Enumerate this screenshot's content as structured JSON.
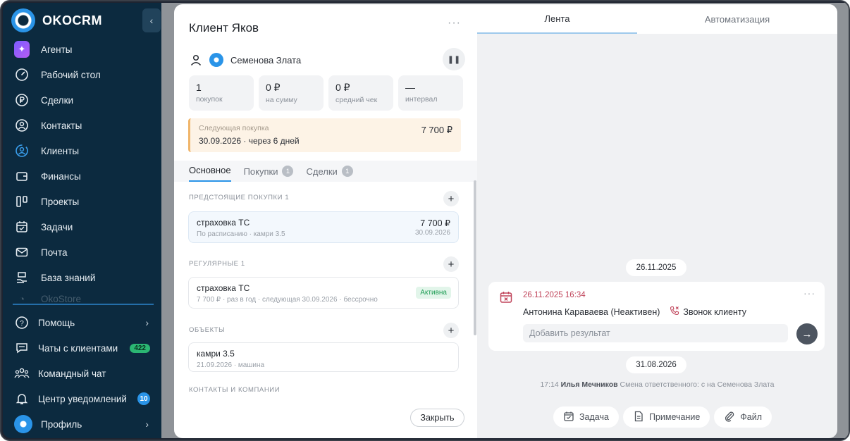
{
  "brand": {
    "name": "OKOCRM"
  },
  "sidebar": {
    "items": [
      {
        "label": "Агенты",
        "icon": "sparkle-icon"
      },
      {
        "label": "Рабочий стол",
        "icon": "gauge-icon"
      },
      {
        "label": "Сделки",
        "icon": "ruble-icon"
      },
      {
        "label": "Контакты",
        "icon": "contact-icon"
      },
      {
        "label": "Клиенты",
        "icon": "client-icon"
      },
      {
        "label": "Финансы",
        "icon": "wallet-icon"
      },
      {
        "label": "Проекты",
        "icon": "kanban-icon"
      },
      {
        "label": "Задачи",
        "icon": "calendar-check-icon"
      },
      {
        "label": "Почта",
        "icon": "mail-icon"
      },
      {
        "label": "База знаний",
        "icon": "book-hand-icon"
      },
      {
        "label": "OkoStore",
        "icon": "store-icon"
      }
    ],
    "bottom": [
      {
        "label": "Помощь",
        "icon": "help-icon"
      },
      {
        "label": "Чаты с клиентами",
        "icon": "chat-icon",
        "badge": "422"
      },
      {
        "label": "Командный чат",
        "icon": "team-icon"
      },
      {
        "label": "Центр уведомлений",
        "icon": "bell-icon",
        "badge": "10"
      },
      {
        "label": "Профиль",
        "icon": "profile-avatar"
      }
    ],
    "accent": "#2a94e8"
  },
  "client": {
    "title": "Клиент Яков",
    "owner": "Семенова Злата",
    "stats": [
      {
        "value": "1",
        "label": "покупок"
      },
      {
        "value": "0 ₽",
        "label": "на сумму"
      },
      {
        "value": "0 ₽",
        "label": "средний чек"
      },
      {
        "value": "—",
        "label": "интервал"
      }
    ],
    "next_purchase": {
      "label": "Следующая покупка",
      "date": "30.09.2026 · через 6 дней",
      "amount": "7 700 ₽"
    },
    "tabs": [
      {
        "label": "Основное"
      },
      {
        "label": "Покупки",
        "count": "1"
      },
      {
        "label": "Сделки",
        "count": "1"
      }
    ],
    "sections": {
      "upcoming": {
        "title": "ПРЕДСТОЯЩИЕ ПОКУПКИ",
        "count": "1",
        "card": {
          "name": "страховка ТС",
          "sub": "По расписанию · камри 3.5",
          "amount": "7 700 ₽",
          "date": "30.09.2026"
        }
      },
      "regular": {
        "title": "РЕГУЛЯРНЫЕ",
        "count": "1",
        "card": {
          "name": "страховка ТС",
          "sub": "7 700 ₽ · раз в год · следующая 30.09.2026 · бессрочно",
          "status": "Активна"
        }
      },
      "objects": {
        "title": "ОБЪЕКТЫ",
        "card": {
          "name": "камри 3.5",
          "sub": "21.09.2026 · машина"
        }
      },
      "contacts": {
        "title": "КОНТАКТЫ И КОМПАНИИ"
      }
    },
    "close_label": "Закрыть"
  },
  "feed": {
    "tabs": [
      {
        "label": "Лента"
      },
      {
        "label": "Автоматизация"
      }
    ],
    "date1": "26.11.2025",
    "event": {
      "time": "26.11.2025 16:34",
      "person": "Антонина Караваева (Неактивен)",
      "action": "Звонок клиенту",
      "input_placeholder": "Добавить результат"
    },
    "date2": "31.08.2026",
    "log": {
      "time": "17:14",
      "author": "Илья Мечников",
      "text": "Смена ответственного: с на Семенова Злата"
    },
    "actions": [
      {
        "label": "Задача"
      },
      {
        "label": "Примечание"
      },
      {
        "label": "Файл"
      }
    ]
  }
}
